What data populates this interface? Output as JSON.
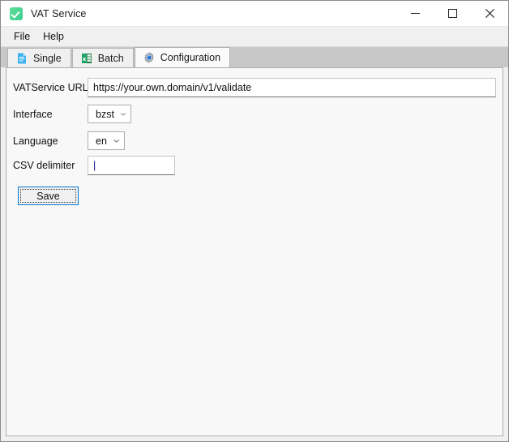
{
  "window": {
    "title": "VAT Service",
    "app_icon": "check-green-icon",
    "controls": {
      "minimize": "minimize-icon",
      "maximize": "maximize-icon",
      "close": "close-icon"
    }
  },
  "menubar": {
    "items": [
      {
        "label": "File"
      },
      {
        "label": "Help"
      }
    ]
  },
  "tabs": [
    {
      "label": "Single",
      "icon": "document-blue-icon",
      "active": false
    },
    {
      "label": "Batch",
      "icon": "spreadsheet-green-icon",
      "active": false
    },
    {
      "label": "Configuration",
      "icon": "gear-icon",
      "active": true
    }
  ],
  "form": {
    "url": {
      "label": "VATService URL",
      "value": "https://your.own.domain/v1/validate",
      "placeholder": ""
    },
    "interface": {
      "label": "Interface",
      "value": "bzst",
      "options": [
        "bzst"
      ]
    },
    "language": {
      "label": "Language",
      "value": "en",
      "options": [
        "en"
      ]
    },
    "delimiter": {
      "label": "CSV delimiter",
      "value": "|",
      "placeholder": ""
    },
    "save_label": "Save"
  },
  "colors": {
    "accent": "#0078d7",
    "app_icon_green": "#3ecf8e",
    "tabstrip_bg": "#c8c8c8",
    "panel_bg": "#f8f8f8"
  }
}
